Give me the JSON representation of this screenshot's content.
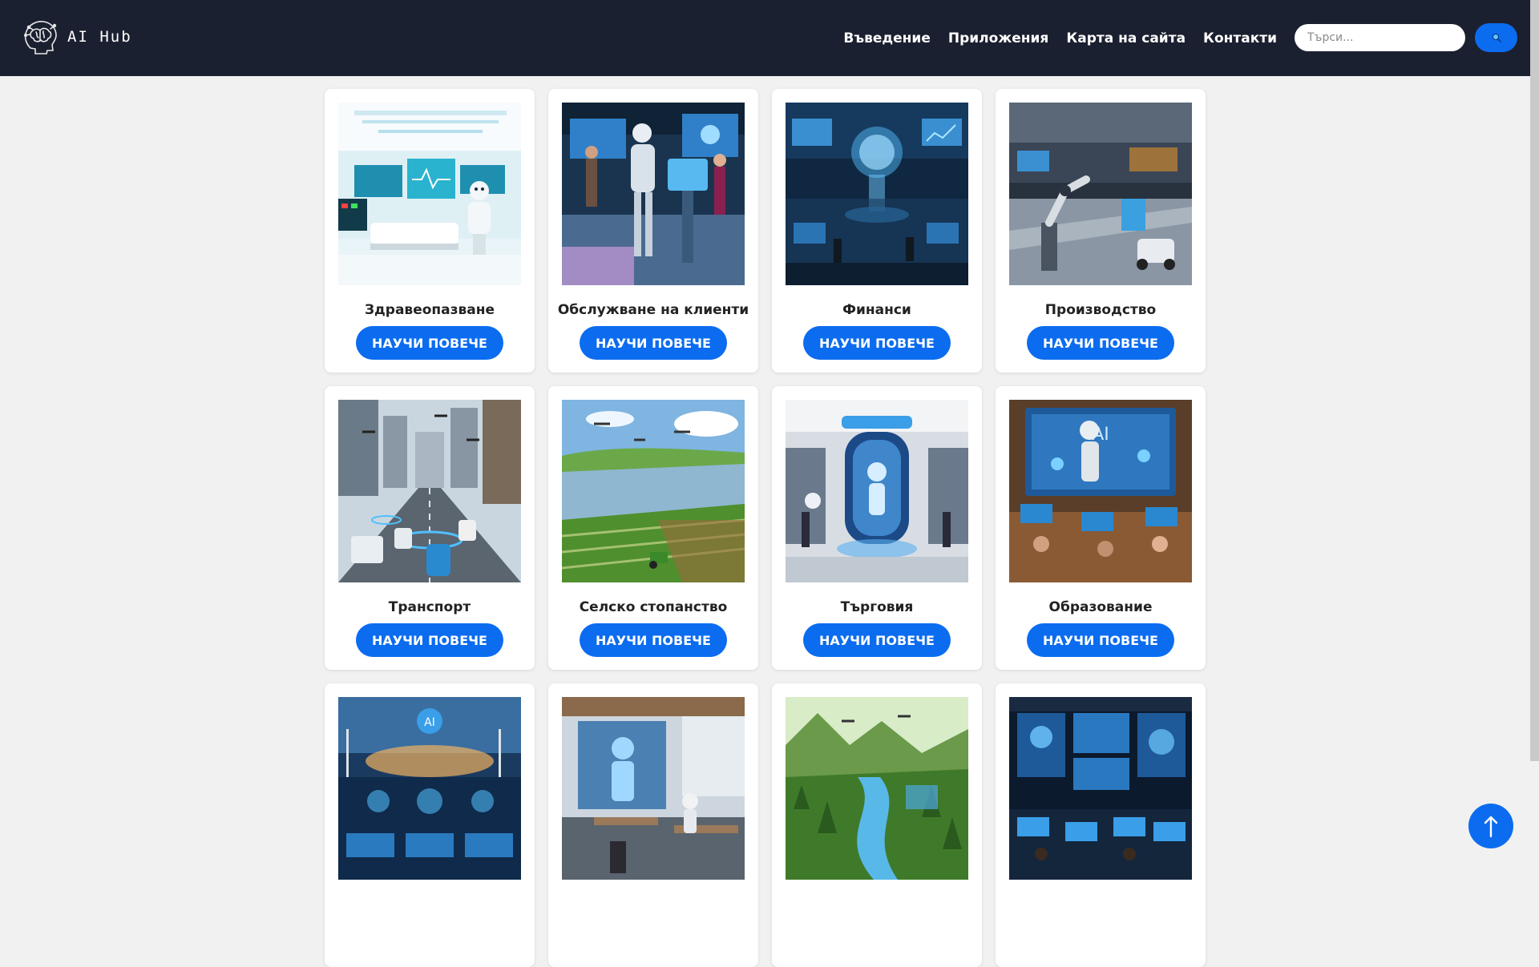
{
  "brand": {
    "name": "AI Hub",
    "logo_icon": "brain-head-icon"
  },
  "nav": {
    "items": [
      {
        "label": "Въведение"
      },
      {
        "label": "Приложения"
      },
      {
        "label": "Карта на сайта"
      },
      {
        "label": "Контакти"
      }
    ]
  },
  "search": {
    "placeholder": "Търси...",
    "value": "",
    "button_icon": "search-icon"
  },
  "cards": [
    {
      "title": "Здравеопазване",
      "button": "НАУЧИ ПОВЕЧЕ",
      "image": "healthcare-robot-image"
    },
    {
      "title": "Обслужване на клиенти",
      "button": "НАУЧИ ПОВЕЧЕ",
      "image": "customer-service-robot-image"
    },
    {
      "title": "Финанси",
      "button": "НАУЧИ ПОВЕЧЕ",
      "image": "finance-hologram-image"
    },
    {
      "title": "Производство",
      "button": "НАУЧИ ПОВЕЧЕ",
      "image": "factory-robot-arm-image"
    },
    {
      "title": "Транспорт",
      "button": "НАУЧИ ПОВЕЧЕ",
      "image": "smart-city-traffic-image"
    },
    {
      "title": "Селско стопанство",
      "button": "НАУЧИ ПОВЕЧЕ",
      "image": "smart-farm-drones-image"
    },
    {
      "title": "Търговия",
      "button": "НАУЧИ ПОВЕЧЕ",
      "image": "retail-store-ai-image"
    },
    {
      "title": "Образование",
      "button": "НАУЧИ ПОВЕЧЕ",
      "image": "classroom-robot-image"
    },
    {
      "title": "",
      "button": "",
      "image": "energy-control-room-image"
    },
    {
      "title": "",
      "button": "",
      "image": "office-ai-hologram-image"
    },
    {
      "title": "",
      "button": "",
      "image": "forest-river-drones-image"
    },
    {
      "title": "",
      "button": "",
      "image": "security-operations-center-image"
    }
  ],
  "back_to_top": {
    "icon": "arrow-up-icon"
  },
  "colors": {
    "navbar_bg": "#1b2030",
    "page_bg": "#f1f1f1",
    "accent": "#0b6cf0",
    "card_bg": "#ffffff"
  }
}
